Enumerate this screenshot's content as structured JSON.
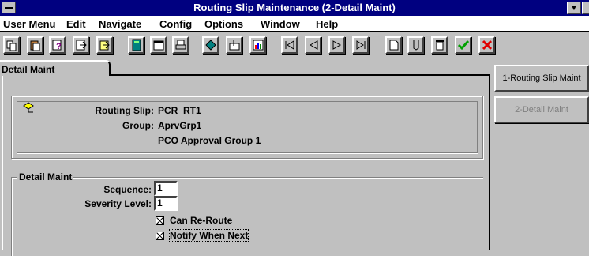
{
  "window": {
    "title": "Routing Slip Maintenance (2-Detail Maint)"
  },
  "menubar": {
    "items": [
      {
        "label": "User Menu"
      },
      {
        "label": "Edit"
      },
      {
        "label": "Navigate"
      },
      {
        "label": "Config"
      },
      {
        "label": "Options"
      },
      {
        "label": "Window"
      },
      {
        "label": "Help"
      }
    ]
  },
  "toolbar": {
    "icons": [
      "copy-icon",
      "paste-icon",
      "query-icon",
      "clear-icon",
      "duplicate-icon",
      "calculator-icon",
      "calendar-icon",
      "print-icon",
      "routing-icon",
      "attach-icon",
      "chart-icon",
      "first-record-icon",
      "previous-record-icon",
      "next-record-icon",
      "last-record-icon",
      "new-record-icon",
      "ship-icon",
      "delete-icon",
      "accept-icon",
      "cancel-icon"
    ]
  },
  "tab": {
    "label": "Detail Maint"
  },
  "header": {
    "routing_slip_label": "Routing Slip:",
    "routing_slip_value": "PCR_RT1",
    "group_label": "Group:",
    "group_value": "AprvGrp1",
    "group_desc": "PCO Approval Group 1"
  },
  "detail": {
    "legend": "Detail Maint",
    "sequence_label": "Sequence:",
    "sequence_value": "1",
    "severity_label": "Severity Level:",
    "severity_value": "1",
    "can_reroute_label": "Can Re-Route",
    "notify_label": "Notify When Next"
  },
  "sidebar": {
    "btn1": "1-Routing Slip Maint",
    "btn2": "2-Detail Maint"
  }
}
